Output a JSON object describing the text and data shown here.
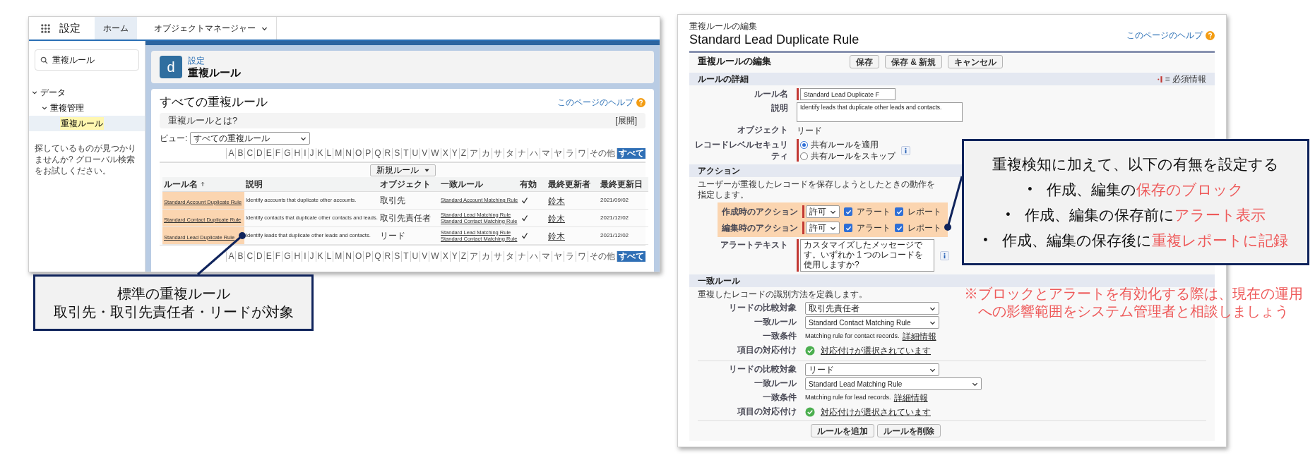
{
  "left_screen": {
    "app_name": "設定",
    "tabs": [
      {
        "label": "ホーム",
        "selected": true,
        "menu": false
      },
      {
        "label": "オブジェクトマネージャー",
        "selected": false,
        "menu": true
      }
    ],
    "sidebar": {
      "search": {
        "value": "重複ルール"
      },
      "tree": [
        {
          "label": "データ",
          "expanded": true,
          "selected": false,
          "children": [
            {
              "label": "重複管理",
              "expanded": true,
              "selected": false,
              "children": [
                {
                  "label": "重複ルール",
                  "expanded": false,
                  "selected": true
                }
              ]
            }
          ]
        }
      ],
      "help_text": "探しているものが見つかりませんか? グローバル検索をお試しください。"
    },
    "header": {
      "icon_letter": "d",
      "breadcrumb": "設定",
      "title": "重複ルール"
    },
    "content": {
      "title": "すべての重複ルール",
      "help_link": "このページのヘルプ",
      "info_box": {
        "title": "重複ルールとは?",
        "toggle": "[展開]"
      },
      "view": {
        "label": "ビュー:",
        "value": "すべての重複ルール"
      },
      "alpha_top": [
        {
          "label": "A",
          "selected": false
        },
        {
          "label": "B",
          "selected": false
        },
        {
          "label": "C",
          "selected": false
        },
        {
          "label": "D",
          "selected": false
        },
        {
          "label": "E",
          "selected": false
        },
        {
          "label": "F",
          "selected": false
        },
        {
          "label": "G",
          "selected": false
        },
        {
          "label": "H",
          "selected": false
        },
        {
          "label": "I",
          "selected": false
        },
        {
          "label": "J",
          "selected": false
        },
        {
          "label": "K",
          "selected": false
        },
        {
          "label": "L",
          "selected": false
        },
        {
          "label": "M",
          "selected": false
        },
        {
          "label": "N",
          "selected": false
        },
        {
          "label": "O",
          "selected": false
        },
        {
          "label": "P",
          "selected": false
        },
        {
          "label": "Q",
          "selected": false
        },
        {
          "label": "R",
          "selected": false
        },
        {
          "label": "S",
          "selected": false
        },
        {
          "label": "T",
          "selected": false
        },
        {
          "label": "U",
          "selected": false
        },
        {
          "label": "V",
          "selected": false
        },
        {
          "label": "W",
          "selected": false
        },
        {
          "label": "X",
          "selected": false
        },
        {
          "label": "Y",
          "selected": false
        },
        {
          "label": "Z",
          "selected": false
        },
        {
          "label": "ア",
          "selected": false
        },
        {
          "label": "カ",
          "selected": false
        },
        {
          "label": "サ",
          "selected": false
        },
        {
          "label": "タ",
          "selected": false
        },
        {
          "label": "ナ",
          "selected": false
        },
        {
          "label": "ハ",
          "selected": false
        },
        {
          "label": "マ",
          "selected": false
        },
        {
          "label": "ヤ",
          "selected": false
        },
        {
          "label": "ラ",
          "selected": false
        },
        {
          "label": "ワ",
          "selected": false
        },
        {
          "label": "その他",
          "selected": false
        },
        {
          "label": "すべて",
          "selected": true
        }
      ],
      "new_button": "新規ルール",
      "table": {
        "columns": [
          {
            "label": "ルール名",
            "sorted": true
          },
          {
            "label": "説明",
            "sorted": false
          },
          {
            "label": "オブジェクト",
            "sorted": false
          },
          {
            "label": "一致ルール",
            "sorted": false
          },
          {
            "label": "有効",
            "sorted": false
          },
          {
            "label": "最終更新者",
            "sorted": false
          },
          {
            "label": "最終更新日",
            "sorted": false
          }
        ],
        "rows": [
          {
            "name": "Standard Account Duplicate Rule",
            "description": "Identify accounts that duplicate other accounts.",
            "object": "取引先",
            "matching_rules": [
              "Standard Account Matching Rule"
            ],
            "active": true,
            "updated_by": "鈴木",
            "updated_on": "2021/09/02"
          },
          {
            "name": "Standard Contact Duplicate Rule",
            "description": "Identify contacts that duplicate other contacts and leads.",
            "object": "取引先責任者",
            "matching_rules": [
              "Standard Lead Matching Rule",
              "Standard Contact Matching Rule"
            ],
            "active": true,
            "updated_by": "鈴木",
            "updated_on": "2021/12/02"
          },
          {
            "name": "Standard Lead Duplicate Rule",
            "description": "Identify leads that duplicate other leads and contacts.",
            "object": "リード",
            "matching_rules": [
              "Standard Lead Matching Rule",
              "Standard Contact Matching Rule"
            ],
            "active": true,
            "updated_by": "鈴木",
            "updated_on": "2021/12/02"
          }
        ]
      },
      "alpha_bottom": [
        {
          "label": "A",
          "selected": false
        },
        {
          "label": "B",
          "selected": false
        },
        {
          "label": "C",
          "selected": false
        },
        {
          "label": "D",
          "selected": false
        },
        {
          "label": "E",
          "selected": false
        },
        {
          "label": "F",
          "selected": false
        },
        {
          "label": "G",
          "selected": false
        },
        {
          "label": "H",
          "selected": false
        },
        {
          "label": "I",
          "selected": false
        },
        {
          "label": "J",
          "selected": false
        },
        {
          "label": "K",
          "selected": false
        },
        {
          "label": "L",
          "selected": false
        },
        {
          "label": "M",
          "selected": false
        },
        {
          "label": "N",
          "selected": false
        },
        {
          "label": "O",
          "selected": false
        },
        {
          "label": "P",
          "selected": false
        },
        {
          "label": "Q",
          "selected": false
        },
        {
          "label": "R",
          "selected": false
        },
        {
          "label": "S",
          "selected": false
        },
        {
          "label": "T",
          "selected": false
        },
        {
          "label": "U",
          "selected": false
        },
        {
          "label": "V",
          "selected": false
        },
        {
          "label": "W",
          "selected": false
        },
        {
          "label": "X",
          "selected": false
        },
        {
          "label": "Y",
          "selected": false
        },
        {
          "label": "Z",
          "selected": false
        },
        {
          "label": "ア",
          "selected": false
        },
        {
          "label": "カ",
          "selected": false
        },
        {
          "label": "サ",
          "selected": false
        },
        {
          "label": "タ",
          "selected": false
        },
        {
          "label": "ナ",
          "selected": false
        },
        {
          "label": "ハ",
          "selected": false
        },
        {
          "label": "マ",
          "selected": false
        },
        {
          "label": "ヤ",
          "selected": false
        },
        {
          "label": "ラ",
          "selected": false
        },
        {
          "label": "ワ",
          "selected": false
        },
        {
          "label": "その他",
          "selected": false
        },
        {
          "label": "すべて",
          "selected": true
        }
      ]
    }
  },
  "left_callout": {
    "lines": [
      "標準の重複ルール",
      "取引先・取引先責任者・リードが対象"
    ]
  },
  "right_screen": {
    "breadcrumb": "重複ルールの編集",
    "title": "Standard Lead Duplicate Rule",
    "help_link": "このページのヘルプ",
    "panel": {
      "title": "重複ルールの編集",
      "buttons": [
        "保存",
        "保存 & 新規",
        "キャンセル"
      ]
    },
    "details": {
      "title": "ルールの詳細",
      "required_legend": "= 必須情報",
      "rule_name": {
        "label": "ルール名",
        "value": "Standard Lead Duplicate F"
      },
      "description": {
        "label": "説明",
        "value": "Identify leads that duplicate other leads and contacts."
      },
      "object": {
        "label": "オブジェクト",
        "value": "リード"
      },
      "security": {
        "label": "レコードレベルセキュリティ",
        "options": [
          {
            "label": "共有ルールを適用",
            "selected": true
          },
          {
            "label": "共有ルールをスキップ",
            "selected": false
          }
        ]
      }
    },
    "actions": {
      "title": "アクション",
      "description": "ユーザーが重複したレコードを保存しようとしたときの動作を指定します。",
      "rows": [
        {
          "label": "作成時のアクション",
          "value": "許可",
          "alert": {
            "label": "アラート",
            "checked": true
          },
          "report": {
            "label": "レポート",
            "checked": true
          }
        },
        {
          "label": "編集時のアクション",
          "value": "許可",
          "alert": {
            "label": "アラート",
            "checked": true
          },
          "report": {
            "label": "レポート",
            "checked": true
          }
        }
      ],
      "alert_text": {
        "label": "アラートテキスト",
        "value": "カスタマイズしたメッセージです。いずれか 1 つのレコードを使用しますか?"
      }
    },
    "matching": {
      "title": "一致ルール",
      "description": "重複したレコードの識別方法を定義します。",
      "blocks": [
        {
          "compare": {
            "label": "リードの比較対象",
            "value": "取引先責任者"
          },
          "rule": {
            "label": "一致ルール",
            "value": "Standard Contact Matching Rule"
          },
          "criteria": {
            "label": "一致条件",
            "text": "Matching rule for contact records.",
            "link": "詳細情報"
          },
          "mapping": {
            "label": "項目の対応付け",
            "link": "対応付けが選択されています"
          }
        },
        {
          "compare": {
            "label": "リードの比較対象",
            "value": "リード"
          },
          "rule": {
            "label": "一致ルール",
            "value": "Standard Lead Matching Rule"
          },
          "criteria": {
            "label": "一致条件",
            "text": "Matching rule for lead records.",
            "link": "詳細情報"
          },
          "mapping": {
            "label": "項目の対応付け",
            "link": "対応付けが選択されています"
          }
        }
      ],
      "buttons": [
        "ルールを追加",
        "ルールを削除"
      ]
    }
  },
  "right_callout": {
    "heading": "重複検知に加えて、以下の有無を設定する",
    "items": [
      {
        "bullet": "•",
        "text": "作成、編集の",
        "highlight": "保存のブロック"
      },
      {
        "bullet": "•",
        "text": "作成、編集の保存前に",
        "highlight": "アラート表示"
      },
      {
        "bullet": "•",
        "text": "作成、編集の保存後に",
        "highlight": "重複レポートに記録"
      }
    ]
  },
  "note": "※ブロックとアラートを有効化する際は、現在の運用への影響範囲をシステム管理者と相談しましょう"
}
